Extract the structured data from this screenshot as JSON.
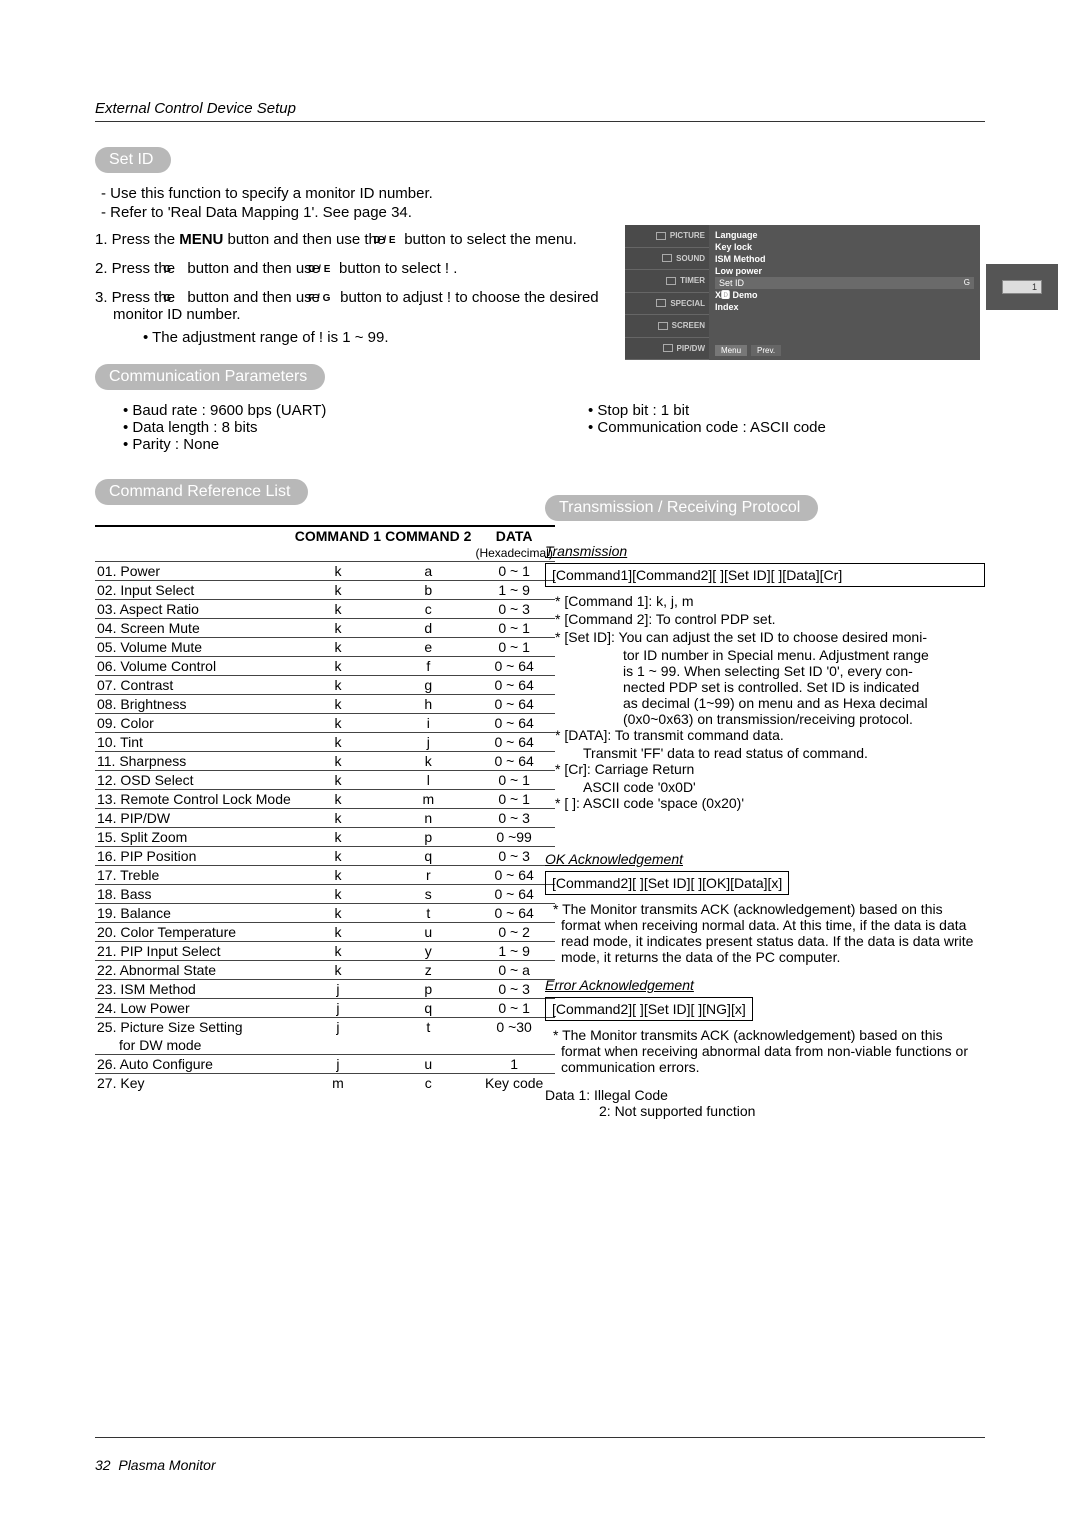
{
  "header": {
    "title": "External Control Device Setup"
  },
  "set_id": {
    "heading": "Set ID",
    "bullets": [
      "Use this function to specify a monitor ID number.",
      "Refer to 'Real Data Mapping 1'. See page 34."
    ],
    "step1a": "1. Press the ",
    "step1b": "MENU",
    "step1c": " button and then use the ",
    "step1d": "D / E",
    "step1e": " button to select the menu.",
    "step2a": "2. Press the ",
    "step2b": "G",
    "step2c": " button and then use ",
    "step2d": "D / E",
    "step2e": " button to select       !    .",
    "step3a": "3. Press the ",
    "step3b": "G",
    "step3c": " button and then use ",
    "step3d": "F / G",
    "step3e": " button to adjust        !      to choose the desired monitor ID number.",
    "range_note": "• The adjustment range of       !      is 1 ~ 99."
  },
  "comm_params": {
    "heading": "Communication Parameters",
    "left": [
      "Baud rate : 9600 bps (UART)",
      "Data length : 8 bits",
      "Parity : None"
    ],
    "right": [
      "Stop bit : 1 bit",
      "Communication code : ASCII code"
    ]
  },
  "cmd_list": {
    "heading": "Command Reference List",
    "th1": "",
    "th2": "COMMAND 1",
    "th3": "COMMAND 2",
    "th4": "DATA",
    "th4sub": "(Hexadecimal)",
    "rows": [
      {
        "n": "01. Power",
        "c1": "k",
        "c2": "a",
        "d": "0 ~ 1"
      },
      {
        "n": "02. Input Select",
        "c1": "k",
        "c2": "b",
        "d": "1 ~ 9"
      },
      {
        "n": "03. Aspect Ratio",
        "c1": "k",
        "c2": "c",
        "d": "0 ~ 3"
      },
      {
        "n": "04. Screen Mute",
        "c1": "k",
        "c2": "d",
        "d": "0 ~ 1"
      },
      {
        "n": "05. Volume Mute",
        "c1": "k",
        "c2": "e",
        "d": "0 ~ 1"
      },
      {
        "n": "06. Volume Control",
        "c1": "k",
        "c2": "f",
        "d": "0 ~ 64"
      },
      {
        "n": "07. Contrast",
        "c1": "k",
        "c2": "g",
        "d": "0 ~ 64"
      },
      {
        "n": "08. Brightness",
        "c1": "k",
        "c2": "h",
        "d": "0 ~ 64"
      },
      {
        "n": "09. Color",
        "c1": "k",
        "c2": "i",
        "d": "0 ~ 64"
      },
      {
        "n": "10. Tint",
        "c1": "k",
        "c2": "j",
        "d": "0 ~ 64"
      },
      {
        "n": "11. Sharpness",
        "c1": "k",
        "c2": "k",
        "d": "0 ~ 64"
      },
      {
        "n": "12. OSD Select",
        "c1": "k",
        "c2": "l",
        "d": "0 ~ 1"
      },
      {
        "n": "13. Remote Control Lock Mode",
        "c1": "k",
        "c2": "m",
        "d": "0 ~ 1"
      },
      {
        "n": "14. PIP/DW",
        "c1": "k",
        "c2": "n",
        "d": "0 ~ 3"
      },
      {
        "n": "15. Split Zoom",
        "c1": "k",
        "c2": "p",
        "d": "0 ~99"
      },
      {
        "n": "16. PIP Position",
        "c1": "k",
        "c2": "q",
        "d": "0 ~ 3"
      },
      {
        "n": "17. Treble",
        "c1": "k",
        "c2": "r",
        "d": "0 ~ 64"
      },
      {
        "n": "18. Bass",
        "c1": "k",
        "c2": "s",
        "d": "0 ~ 64"
      },
      {
        "n": "19. Balance",
        "c1": "k",
        "c2": "t",
        "d": "0 ~ 64"
      },
      {
        "n": "20. Color Temperature",
        "c1": "k",
        "c2": "u",
        "d": "0 ~ 2"
      },
      {
        "n": "21. PIP Input Select",
        "c1": "k",
        "c2": "y",
        "d": "1 ~ 9"
      },
      {
        "n": "22. Abnormal State",
        "c1": "k",
        "c2": "z",
        "d": "0 ~ a"
      },
      {
        "n": "23. ISM Method",
        "c1": "j",
        "c2": "p",
        "d": "0 ~ 3"
      },
      {
        "n": "24. Low Power",
        "c1": "j",
        "c2": "q",
        "d": "0 ~ 1"
      },
      {
        "n": "25. Picture Size Setting",
        "c1": "j",
        "c2": "t",
        "d": "0 ~30",
        "extra": "for DW mode"
      },
      {
        "n": "26. Auto Configure",
        "c1": "j",
        "c2": "u",
        "d": "1"
      },
      {
        "n": "27. Key",
        "c1": "m",
        "c2": "c",
        "d": "Key code"
      }
    ]
  },
  "protocol": {
    "heading": "Transmission / Receiving  Protocol",
    "trans_title": "Transmission",
    "trans_box": "[Command1][Command2][  ][Set ID][  ][Data][Cr]",
    "notes": [
      "* [Command 1]: k, j, m",
      "* [Command 2]: To control PDP set.",
      "* [Set ID]: You can adjust the set ID to choose desired moni-",
      "tor ID number in Special menu. Adjustment range",
      "is 1 ~ 99. When selecting Set ID '0', every con-",
      "nected PDP set is controlled. Set ID is indicated",
      "as decimal (1~99) on menu and as Hexa decimal",
      "(0x0~0x63) on transmission/receiving protocol.",
      "* [DATA]: To transmit command data.",
      "Transmit 'FF' data to read status of command.",
      "* [Cr]: Carriage Return",
      "ASCII code '0x0D'",
      "* [   ]: ASCII code 'space (0x20)'"
    ],
    "ok_title": "OK Acknowledgement",
    "ok_box": "[Command2][  ][Set ID][  ][OK][Data][x]",
    "ok_note": "* The Monitor transmits ACK (acknowledgement) based on this format when receiving normal data. At this time, if the data is data read mode, it indicates present status data. If the data is data write mode, it returns the data of the PC computer.",
    "err_title": "Error Acknowledgement",
    "err_box": "[Command2][  ][Set ID][  ][NG][x]",
    "err_note": "* The Monitor transmits ACK (acknowledgement) based on this format when receiving abnormal data from non-viable functions or communication errors.",
    "data1": "Data  1: Illegal Code",
    "data2": "2: Not supported function"
  },
  "osd": {
    "tabs": [
      "PICTURE",
      "SOUND",
      "TIMER",
      "SPECIAL",
      "SCREEN",
      "PIP/DW"
    ],
    "lines": [
      "Language",
      "Key lock",
      "ISM Method",
      "Low power",
      "Set ID",
      "X🅳 Demo",
      "Index"
    ],
    "g": "G",
    "num": "1",
    "menu": "Menu",
    "prev": "Prev."
  },
  "footer": {
    "page": "32",
    "label": "Plasma Monitor"
  }
}
